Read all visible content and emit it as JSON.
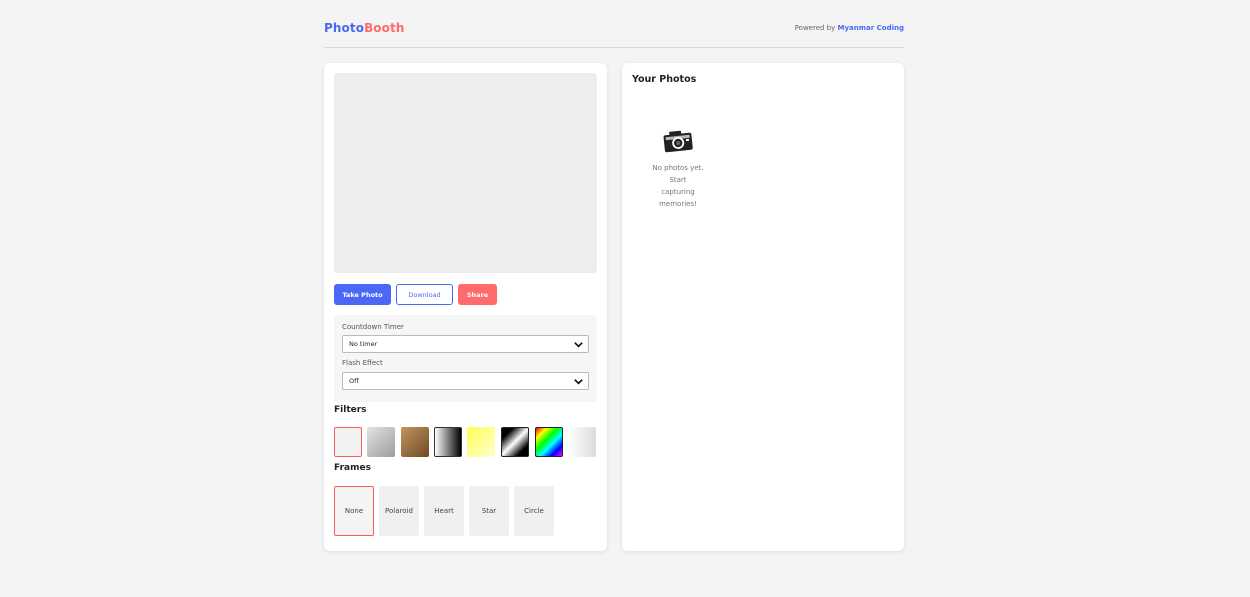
{
  "header": {
    "logo_part1": "Photo",
    "logo_part2": "Booth",
    "powered_prefix": "Powered by",
    "powered_link": "Myanmar Coding"
  },
  "camera": {
    "buttons": {
      "take_photo": "Take Photo",
      "download": "Download",
      "share": "Share"
    },
    "settings": {
      "countdown_label": "Countdown Timer",
      "countdown_value": "No timer",
      "flash_label": "Flash Effect",
      "flash_value": "Off"
    },
    "filters_title": "Filters",
    "filters": [
      {
        "name": "none",
        "selected": true
      },
      {
        "name": "grayscale"
      },
      {
        "name": "sepia"
      },
      {
        "name": "contrast"
      },
      {
        "name": "brightness"
      },
      {
        "name": "invert"
      },
      {
        "name": "hue-rotate"
      },
      {
        "name": "blur"
      }
    ],
    "frames_title": "Frames",
    "frames": [
      {
        "label": "None",
        "selected": true
      },
      {
        "label": "Polaroid"
      },
      {
        "label": "Heart"
      },
      {
        "label": "Star"
      },
      {
        "label": "Circle"
      }
    ]
  },
  "gallery": {
    "title": "Your Photos",
    "empty_icon": "camera-icon",
    "empty_text": "No photos yet. Start capturing memories!"
  },
  "colors": {
    "primary": "#4a68f5",
    "accent": "#ff6b6b"
  }
}
